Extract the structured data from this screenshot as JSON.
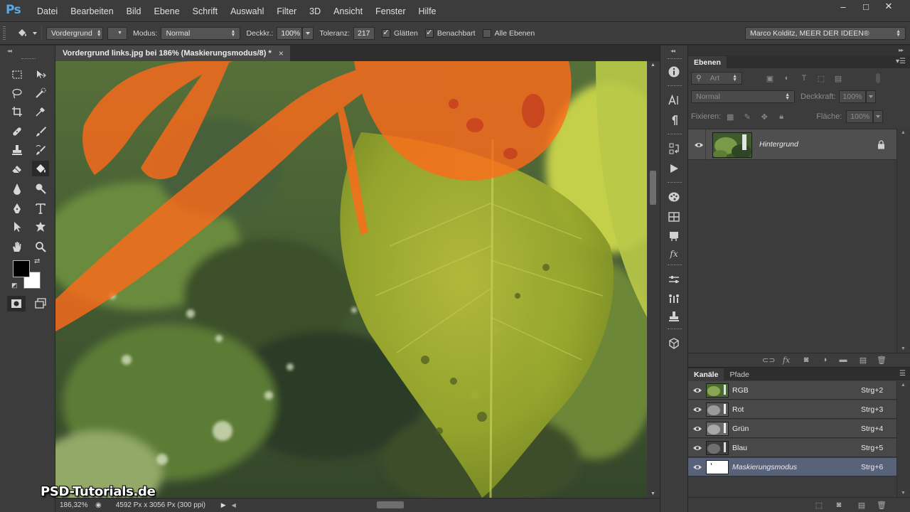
{
  "app": {
    "logo": "Ps",
    "menu": [
      "Datei",
      "Bearbeiten",
      "Bild",
      "Ebene",
      "Schrift",
      "Auswahl",
      "Filter",
      "3D",
      "Ansicht",
      "Fenster",
      "Hilfe"
    ],
    "window_controls": {
      "minimize": "–",
      "maximize": "□",
      "close": "✕"
    }
  },
  "options": {
    "fill_source": "Vordergrund",
    "mode_label": "Modus:",
    "mode_value": "Normal",
    "opacity_label": "Deckkr.:",
    "opacity_value": "100%",
    "tolerance_label": "Toleranz:",
    "tolerance_value": "217",
    "smooth_label": "Glätten",
    "smooth_checked": true,
    "contiguous_label": "Benachbart",
    "contiguous_checked": true,
    "all_layers_label": "Alle Ebenen",
    "all_layers_checked": false,
    "workspace": "Marco Kolditz, MEER DER IDEEN®"
  },
  "document": {
    "tab_title": "Vordergrund links.jpg bei 186% (Maskierungsmodus/8) *",
    "close_glyph": "×",
    "zoom": "186,32%",
    "size_info": "4592 Px x 3056 Px (300 ppi)"
  },
  "watermark": "PSD-Tutorials.de",
  "tools": {
    "foreground_color": "#000000",
    "background_color": "#ffffff"
  },
  "layers_panel": {
    "tab": "Ebenen",
    "filter_kind": "Art",
    "blend_mode": "Normal",
    "opacity_label": "Deckkraft:",
    "opacity_value": "100%",
    "lock_label": "Fixieren:",
    "fill_label": "Fläche:",
    "fill_value": "100%",
    "layers": [
      {
        "name": "Hintergrund",
        "locked": true,
        "visible": true
      }
    ],
    "footer_icons": [
      "link-icon",
      "fx-icon",
      "mask-icon",
      "adjustment-icon",
      "folder-icon",
      "new-layer-icon",
      "trash-icon"
    ]
  },
  "channels_panel": {
    "tabs": [
      "Kanäle",
      "Pfade"
    ],
    "channels": [
      {
        "name": "RGB",
        "shortcut": "Strg+2",
        "selected": false,
        "italic": false
      },
      {
        "name": "Rot",
        "shortcut": "Strg+3",
        "selected": false,
        "italic": false
      },
      {
        "name": "Grün",
        "shortcut": "Strg+4",
        "selected": false,
        "italic": false
      },
      {
        "name": "Blau",
        "shortcut": "Strg+5",
        "selected": false,
        "italic": false
      },
      {
        "name": "Maskierungsmodus",
        "shortcut": "Strg+6",
        "selected": true,
        "italic": true
      }
    ]
  },
  "colors": {
    "mask_overlay": "#ff6a1a",
    "selected_row": "#58637a",
    "ps_blue": "#5aa9e6"
  }
}
